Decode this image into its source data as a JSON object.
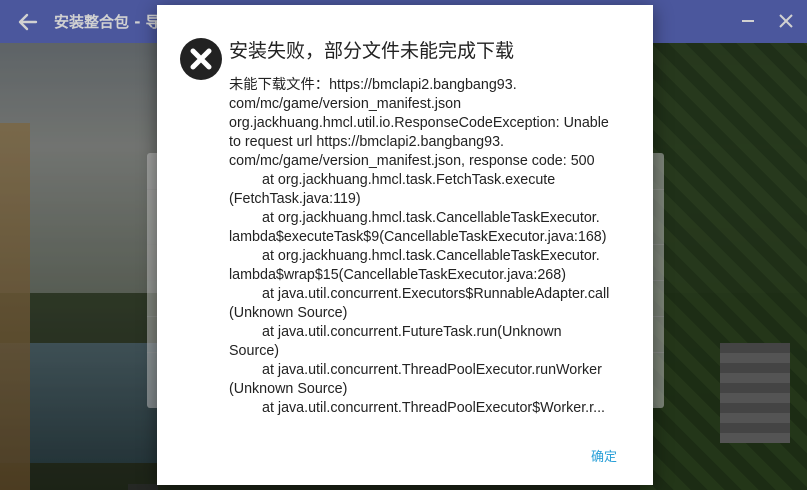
{
  "titlebar": {
    "title": "安装整合包 - 导入",
    "back_icon": "arrow-left-icon",
    "minimize_icon": "minimize-icon",
    "close_icon": "close-icon"
  },
  "dialog": {
    "icon": "error-x-icon",
    "title": "安装失败，部分文件未能完成下载",
    "message_lines": [
      "未能下载文件：https://bmclapi2.bangbang93.",
      "com/mc/game/version_manifest.json",
      "org.jackhuang.hmcl.util.io.ResponseCodeException: Unable",
      "to request url https://bmclapi2.bangbang93.",
      "com/mc/game/version_manifest.json, response code: 500",
      "at org.jackhuang.hmcl.task.FetchTask.execute",
      "(FetchTask.java:119)",
      "at org.jackhuang.hmcl.task.CancellableTaskExecutor.",
      "lambda$executeTask$9(CancellableTaskExecutor.java:168)",
      "at org.jackhuang.hmcl.task.CancellableTaskExecutor.",
      "lambda$wrap$15(CancellableTaskExecutor.java:268)",
      "at java.util.concurrent.Executors$RunnableAdapter.call",
      "(Unknown Source)",
      "at java.util.concurrent.FutureTask.run(Unknown",
      "Source)",
      "at java.util.concurrent.ThreadPoolExecutor.runWorker",
      "(Unknown Source)",
      "at java.util.concurrent.ThreadPoolExecutor$Worker.r..."
    ],
    "ok_label": "确定",
    "accent_color": "#2aa0d8"
  },
  "colors": {
    "titlebar": "#5c6bc0",
    "error_icon": "#222222"
  }
}
